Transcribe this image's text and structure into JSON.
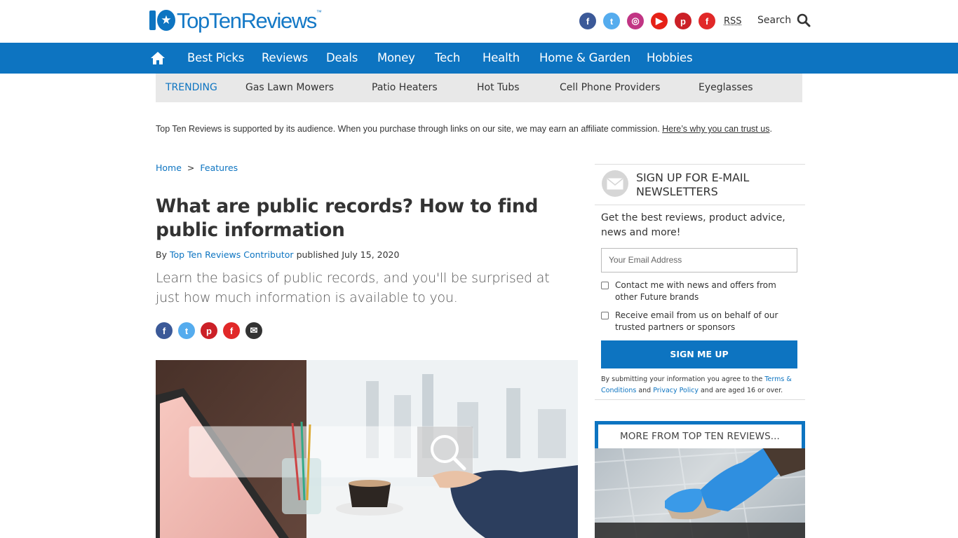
{
  "header": {
    "logo_text": "TopTenReviews",
    "logo_tm": "™",
    "social": [
      {
        "icon": "facebook-icon",
        "glyph": "f",
        "color": "#3b5998"
      },
      {
        "icon": "twitter-icon",
        "glyph": "t",
        "color": "#55acee"
      },
      {
        "icon": "instagram-icon",
        "glyph": "◎",
        "color": "#c13584"
      },
      {
        "icon": "youtube-icon",
        "glyph": "▶",
        "color": "#e62117"
      },
      {
        "icon": "pinterest-icon",
        "glyph": "p",
        "color": "#cb2027"
      },
      {
        "icon": "flipboard-icon",
        "glyph": "f",
        "color": "#e12828"
      }
    ],
    "rss_label": "RSS",
    "search_label": "Search"
  },
  "nav": {
    "items": [
      "Best Picks",
      "Reviews",
      "Deals",
      "Money",
      "Tech",
      "Health",
      "Home & Garden",
      "Hobbies"
    ]
  },
  "trending": {
    "label": "TRENDING",
    "items": [
      "Gas Lawn Mowers",
      "Patio Heaters",
      "Hot Tubs",
      "Cell Phone Providers",
      "Eyeglasses"
    ]
  },
  "disclaimer": {
    "text": "Top Ten Reviews is supported by its audience. When you purchase through links on our site, we may earn an affiliate commission. ",
    "link": "Here’s why you can trust us",
    "end": "."
  },
  "article": {
    "breadcrumb": [
      "Home",
      "Features"
    ],
    "breadcrumb_sep": ">",
    "title": "What are public records? How to find public information",
    "by_prefix": "By",
    "author": "Top Ten Reviews Contributor",
    "published": "published July 15, 2020",
    "standfirst": "Learn the basics of public records, and you'll be surprised at just how much information is available to you.",
    "share": [
      {
        "icon": "facebook-share-icon",
        "glyph": "f",
        "color": "#3b5998"
      },
      {
        "icon": "twitter-share-icon",
        "glyph": "t",
        "color": "#55acee"
      },
      {
        "icon": "pinterest-share-icon",
        "glyph": "p",
        "color": "#cb2027"
      },
      {
        "icon": "flipboard-share-icon",
        "glyph": "f",
        "color": "#e12828"
      },
      {
        "icon": "email-share-icon",
        "glyph": "✉",
        "color": "#333333"
      }
    ]
  },
  "newsletter": {
    "title_line1": "SIGN UP FOR E-MAIL",
    "title_line2": "NEWSLETTERS",
    "subtitle": "Get the best reviews, product advice, news and more!",
    "email_placeholder": "Your Email Address",
    "check1": "Contact me with news and offers from other Future brands",
    "check2": "Receive email from us on behalf of our trusted partners or sponsors",
    "button": "SIGN ME UP",
    "legal_1": "By submitting your information you agree to the ",
    "legal_terms": "Terms & Conditions",
    "legal_2": " and ",
    "legal_privacy": "Privacy Policy",
    "legal_3": " and are aged 16 or over."
  },
  "more": {
    "heading": "MORE FROM TOP TEN REVIEWS..."
  },
  "colors": {
    "brand_blue": "#0d74c1",
    "trending_bg": "#e8e8e8"
  }
}
